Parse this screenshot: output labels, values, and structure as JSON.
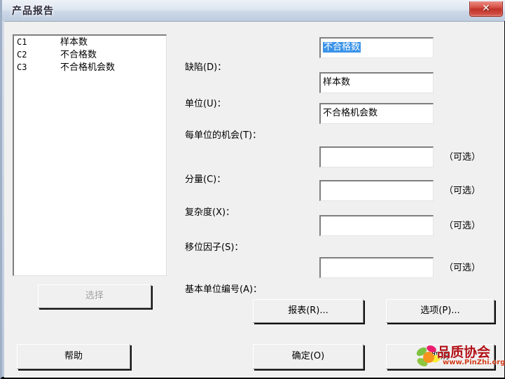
{
  "window": {
    "title": "产品报告",
    "close_label": "✕",
    "close_icon": "close-icon"
  },
  "listbox": {
    "items": [
      {
        "column": "C1",
        "name": "样本数"
      },
      {
        "column": "C2",
        "name": "不合格数"
      },
      {
        "column": "C3",
        "name": "不合格机会数"
      }
    ]
  },
  "buttons": {
    "select": "选择",
    "help": "帮助",
    "report": "报表(R)...",
    "options": "选项(P)...",
    "ok": "确定(O)",
    "cancel": "取消"
  },
  "form": {
    "optional_note": "（可选）",
    "fields": [
      {
        "label": "缺陷(D)：",
        "value": "不合格数",
        "selected": true,
        "optional": false
      },
      {
        "label": "单位(U)：",
        "value": "样本数",
        "selected": false,
        "optional": false
      },
      {
        "label": "每单位的机会(T)：",
        "value": "不合格机会数",
        "selected": false,
        "optional": false
      },
      {
        "label": "分量(C)：",
        "value": "",
        "selected": false,
        "optional": true
      },
      {
        "label": "复杂度(X)：",
        "value": "",
        "selected": false,
        "optional": true
      },
      {
        "label": "移位因子(S)：",
        "value": "",
        "selected": false,
        "optional": true
      },
      {
        "label": "基本单位编号(A)：",
        "value": "",
        "selected": false,
        "optional": true
      }
    ]
  },
  "watermark": {
    "text": "品质协会",
    "url": "www.PinZhi.org"
  },
  "colors": {
    "dialog_bg": "#f0f0f0",
    "title_bg": "#d4dce8",
    "close_red": "#c0332a",
    "selection_blue": "#3a93e8",
    "watermark_red": "#b11116"
  }
}
